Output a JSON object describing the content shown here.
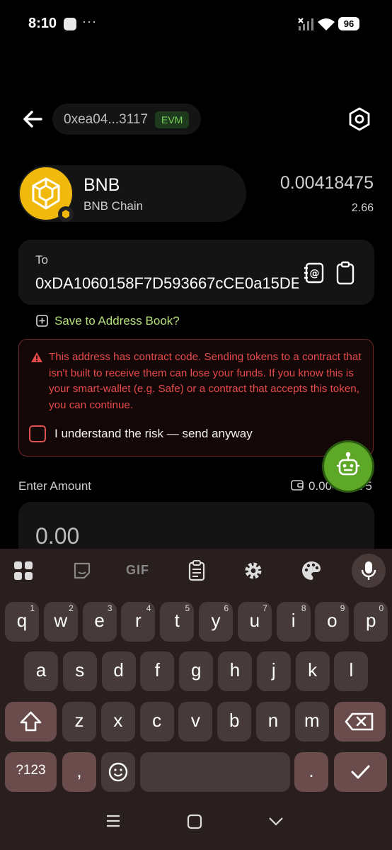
{
  "status_bar": {
    "time": "8:10",
    "dots": "···",
    "battery": "96"
  },
  "header": {
    "address": "0xea04...3117",
    "network_badge": "EVM"
  },
  "token": {
    "symbol": "BNB",
    "chain": "BNB Chain",
    "balance": "0.00418475",
    "fiat_value": "2.66"
  },
  "recipient": {
    "label": "To",
    "address": "0xDA1060158F7D593667cCE0a15DE",
    "save_link": "Save to Address Book?"
  },
  "warning": {
    "message": "This address has contract code. Sending tokens to a contract that isn't built to receive them can lose your funds. If you know this is your smart-wallet (e.g. Safe) or a contract that accepts this token, you can continue.",
    "checkbox_label": "I understand the risk — send anyway"
  },
  "amount": {
    "label": "Enter Amount",
    "available": "0.00418475",
    "value": "0.00"
  },
  "keyboard": {
    "row1": [
      {
        "k": "q",
        "n": "1"
      },
      {
        "k": "w",
        "n": "2"
      },
      {
        "k": "e",
        "n": "3"
      },
      {
        "k": "r",
        "n": "4"
      },
      {
        "k": "t",
        "n": "5"
      },
      {
        "k": "y",
        "n": "6"
      },
      {
        "k": "u",
        "n": "7"
      },
      {
        "k": "i",
        "n": "8"
      },
      {
        "k": "o",
        "n": "9"
      },
      {
        "k": "p",
        "n": "0"
      }
    ],
    "row2": [
      "a",
      "s",
      "d",
      "f",
      "g",
      "h",
      "j",
      "k",
      "l"
    ],
    "row3": [
      "z",
      "x",
      "c",
      "v",
      "b",
      "n",
      "m"
    ],
    "symbols_label": "?123",
    "comma": ",",
    "period": ".",
    "gif_label": "GIF"
  },
  "colors": {
    "accent_green": "#b6e07a",
    "warning_red": "#e74a4a",
    "bnb_yellow": "#f0b90b"
  }
}
